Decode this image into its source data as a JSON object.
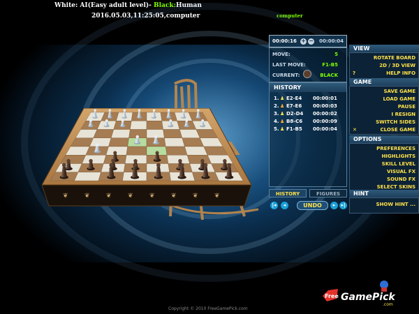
{
  "header": {
    "white_label": "White:",
    "white_value": "AI(Easy adult level)",
    "sep": "- ",
    "black_label": "Black:",
    "black_value": "Human",
    "datetime": "2016.05.03,11:25:05,computer",
    "computer_tag": "computer"
  },
  "clock": {
    "white_time": "00:00:16",
    "black_time": "00:00:04"
  },
  "info": {
    "move_label": "MOVE:",
    "move_value": "5",
    "last_move_label": "LAST MOVE:",
    "last_move_value": "F1-B5",
    "current_label": "CURRENT:",
    "current_value": "BLACK"
  },
  "history": {
    "title": "HISTORY",
    "rows": [
      {
        "n": "1.",
        "move": "E2-E4",
        "time": "00:00:01"
      },
      {
        "n": "2.",
        "move": "E7-E6",
        "time": "00:00:03"
      },
      {
        "n": "3.",
        "move": "D2-D4",
        "time": "00:00:02"
      },
      {
        "n": "4.",
        "move": "B8-C6",
        "time": "00:00:09"
      },
      {
        "n": "5.",
        "move": "F1-B5",
        "time": "00:00:04"
      }
    ]
  },
  "tabs": {
    "history": "HISTORY",
    "figures": "FIGURES"
  },
  "nav": {
    "undo": "UNDO"
  },
  "view": {
    "title": "VIEW",
    "items": [
      "ROTATE BOARD",
      "2D / 3D VIEW",
      "HELP INFO"
    ],
    "help_flag": "?"
  },
  "game": {
    "title": "GAME",
    "items": [
      "SAVE GAME",
      "LOAD GAME",
      "PAUSE",
      "I RESIGN",
      "SWITCH SIDES",
      "CLOSE GAME"
    ],
    "close_flag": "✕"
  },
  "options": {
    "title": "OPTIONS",
    "items": [
      "PREFERENCES",
      "HIGHLIGHTS",
      "SKILL LEVEL",
      "VISUAL FX",
      "SOUND FX",
      "SELECT SKINS"
    ]
  },
  "hint": {
    "title": "HINT",
    "items": [
      "SHOW HINT ..."
    ]
  },
  "footer": {
    "copyright": "Copyright © 2010 FreeGamePick.com",
    "logo_free": "Free",
    "logo_name": "GamePick",
    "logo_domain": ".com"
  },
  "colors": {
    "accent_yellow": "#ffe24a",
    "accent_green": "#7fff00",
    "panel_blue": "#1d3f5c",
    "board_light": "#e7e3d6",
    "board_dark": "#a67c52",
    "frame_wood": "#b98a54"
  }
}
